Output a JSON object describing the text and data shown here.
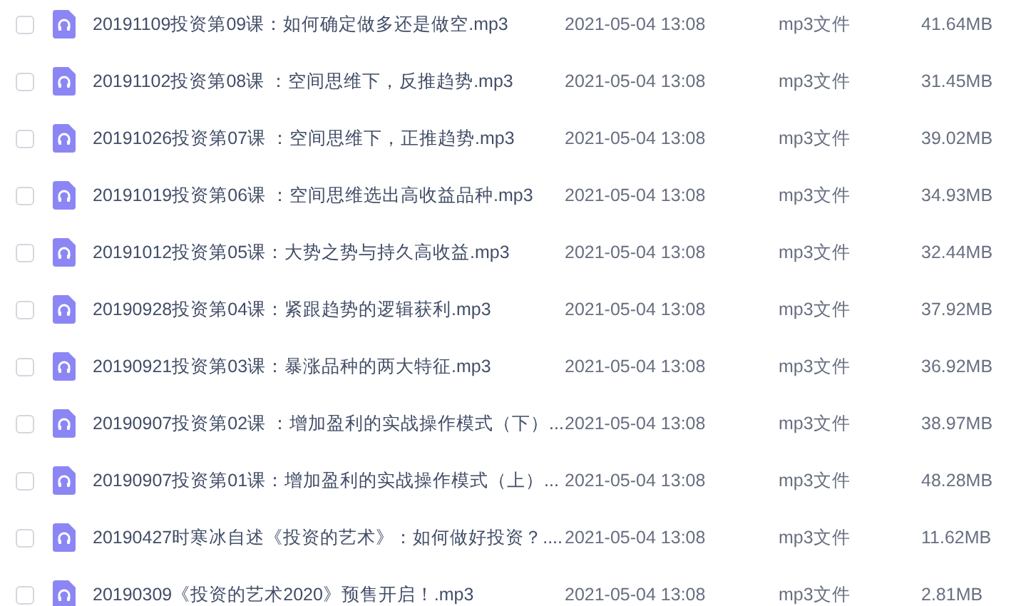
{
  "files": [
    {
      "checked": false,
      "name": "20191109投资第09课：如何确定做多还是做空.mp3",
      "modified": "2021-05-04 13:08",
      "type": "mp3文件",
      "size": "41.64MB"
    },
    {
      "checked": false,
      "name": "20191102投资第08课 ：空间思维下，反推趋势.mp3",
      "modified": "2021-05-04 13:08",
      "type": "mp3文件",
      "size": "31.45MB"
    },
    {
      "checked": false,
      "name": "20191026投资第07课 ：空间思维下，正推趋势.mp3",
      "modified": "2021-05-04 13:08",
      "type": "mp3文件",
      "size": "39.02MB"
    },
    {
      "checked": false,
      "name": "20191019投资第06课 ：空间思维选出高收益品种.mp3",
      "modified": "2021-05-04 13:08",
      "type": "mp3文件",
      "size": "34.93MB"
    },
    {
      "checked": false,
      "name": "20191012投资第05课：大势之势与持久高收益.mp3",
      "modified": "2021-05-04 13:08",
      "type": "mp3文件",
      "size": "32.44MB"
    },
    {
      "checked": false,
      "name": "20190928投资第04课：紧跟趋势的逻辑获利.mp3",
      "modified": "2021-05-04 13:08",
      "type": "mp3文件",
      "size": "37.92MB"
    },
    {
      "checked": false,
      "name": "20190921投资第03课：暴涨品种的两大特征.mp3",
      "modified": "2021-05-04 13:08",
      "type": "mp3文件",
      "size": "36.92MB"
    },
    {
      "checked": false,
      "name": "20190907投资第02课 ：增加盈利的实战操作模式（下）...",
      "modified": "2021-05-04 13:08",
      "type": "mp3文件",
      "size": "38.97MB"
    },
    {
      "checked": false,
      "name": "20190907投资第01课：增加盈利的实战操作模式（上）...",
      "modified": "2021-05-04 13:08",
      "type": "mp3文件",
      "size": "48.28MB"
    },
    {
      "checked": false,
      "name": "20190427时寒冰自述《投资的艺术》：如何做好投资？....",
      "modified": "2021-05-04 13:08",
      "type": "mp3文件",
      "size": "11.62MB"
    },
    {
      "checked": false,
      "name": "20190309《投资的艺术2020》预售开启！.mp3",
      "modified": "2021-05-04 13:08",
      "type": "mp3文件",
      "size": "2.81MB"
    }
  ]
}
